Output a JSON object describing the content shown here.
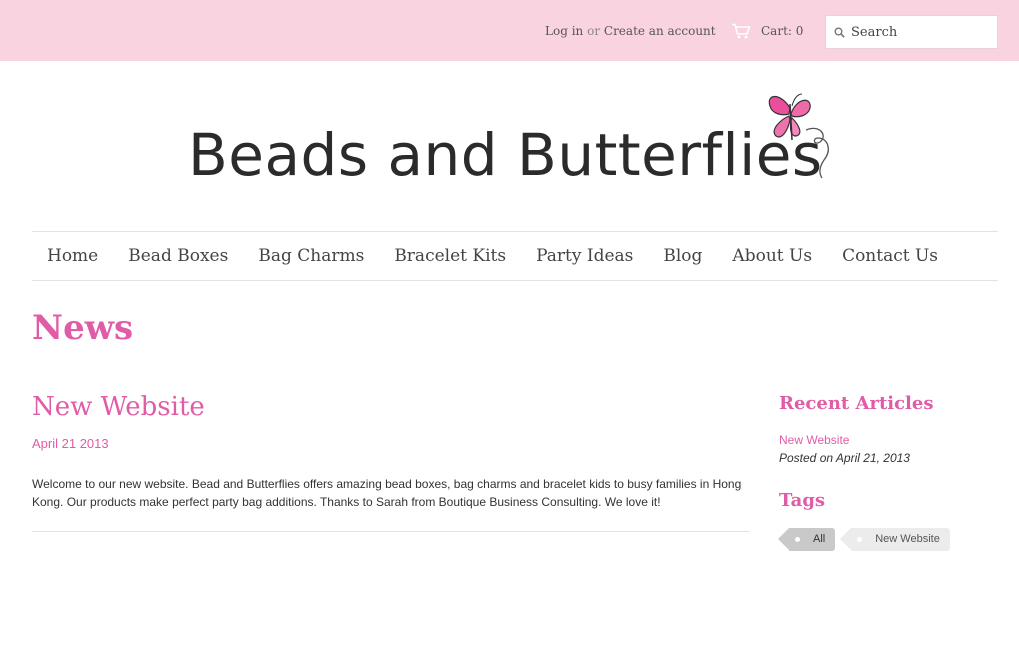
{
  "header": {
    "login_label": "Log in",
    "or_label": "or",
    "create_account_label": "Create an account",
    "cart_label": "Cart: 0",
    "search_placeholder": "Search"
  },
  "logo": {
    "text": "Beads and Butterflies"
  },
  "nav": {
    "items": [
      "Home",
      "Bead Boxes",
      "Bag Charms",
      "Bracelet Kits",
      "Party Ideas",
      "Blog",
      "About Us",
      "Contact Us"
    ]
  },
  "page": {
    "title": "News"
  },
  "article": {
    "title": "New Website",
    "date": "April 21 2013",
    "body": "Welcome to our new website. Bead and Butterflies offers amazing bead boxes, bag charms and bracelet kids to busy families in Hong Kong. Our products make perfect party bag additions. Thanks to Sarah from Boutique Business Consulting. We love it!"
  },
  "sidebar": {
    "recent_heading": "Recent Articles",
    "recent_items": [
      {
        "title": "New Website",
        "meta": "Posted on April 21, 2013"
      }
    ],
    "tags_heading": "Tags",
    "tags": [
      {
        "label": "All",
        "active": true
      },
      {
        "label": "New Website",
        "active": false
      }
    ]
  },
  "colors": {
    "topbar_bg": "#fad3e1",
    "accent": "#e05ca6",
    "text": "#444444"
  },
  "icons": {
    "cart": "cart-icon",
    "search": "search-icon",
    "butterfly": "butterfly-icon"
  }
}
